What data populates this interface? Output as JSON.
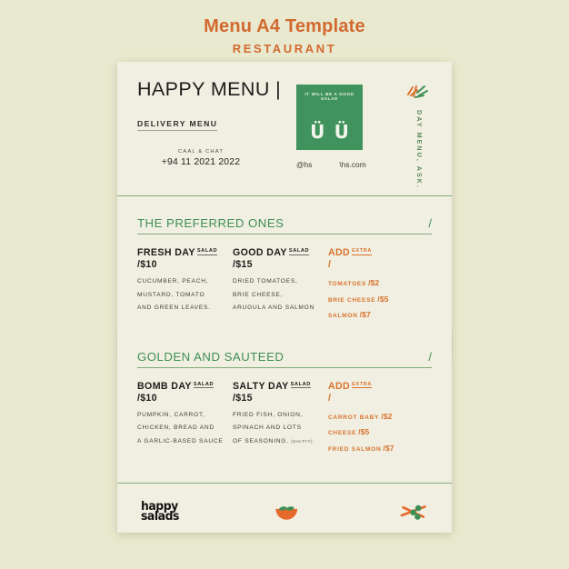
{
  "heading": {
    "title": "Menu A4 Template",
    "subtitle": "RESTAURANT"
  },
  "colors": {
    "page_background": "#e9e9cf",
    "sheet_background": "#f1efe1",
    "accent_orange": "#d2692f",
    "accent_green": "#3e8f56",
    "card_green": "#40935c",
    "circle_green": "#cadfbc",
    "rule_green": "#7fab7e"
  },
  "sheet": {
    "header": {
      "title": "HAPPY MENU  |",
      "subtitle": "DELIVERY MENU",
      "contact_label": "CAAL & CHAT",
      "contact_phone": "+94 11 2021 2022",
      "card": {
        "caption": "IT WILL BE A GOOD SALAD",
        "face_left": "Ü",
        "face_right": "Ü"
      },
      "social": {
        "handle": "@hs",
        "website": "\\hs.com"
      },
      "rail": {
        "vertical_text": "DAY MENU, ASK.",
        "icon": "sprout-icon"
      }
    },
    "sections": [
      {
        "title": "THE PREFERRED ONES",
        "slash": "/",
        "dishes": [
          {
            "name": "FRESH DAY",
            "tag": "SALAD",
            "price": "/$10",
            "lines": [
              "CUCUMBER, PEACH,",
              "MUSTARD, TOMATO",
              "AND GREEN LEAVES."
            ],
            "note": ""
          },
          {
            "name": "GOOD DAY",
            "tag": "SALAD",
            "price": "/$15",
            "lines": [
              "DRIED TOMATOES,",
              "BRIE CHEESE,",
              "ARUGULA AND SALMON"
            ],
            "note": ""
          }
        ],
        "extras": {
          "name": "ADD",
          "tag": "EXTRA",
          "price": "/",
          "items": [
            {
              "label": "TOMATOES",
              "amount": "/$2"
            },
            {
              "label": "BRIE CHEESE",
              "amount": "/$5"
            },
            {
              "label": "SALMON",
              "amount": "/$7"
            }
          ]
        }
      },
      {
        "title": "GOLDEN AND SAUTEED",
        "slash": "/",
        "dishes": [
          {
            "name": "BOMB DAY",
            "tag": "SALAD",
            "price": "/$10",
            "lines": [
              "PUMPKIN, CARROT,",
              "CHICKEN, BREAD AND",
              "A GARLIC-BASED SAUCE"
            ],
            "note": ""
          },
          {
            "name": "SALTY DAY",
            "tag": "SALAD",
            "price": "/$15",
            "lines": [
              "FRIED FISH, ONION,",
              "SPINACH AND LOTS",
              "OF SEASONING."
            ],
            "note": "(SALTYY)"
          }
        ],
        "extras": {
          "name": "ADD",
          "tag": "EXTRA",
          "price": "/",
          "items": [
            {
              "label": "CARROT BABY",
              "amount": "/$2"
            },
            {
              "label": "CHEESE",
              "amount": "/$5"
            },
            {
              "label": "FRIED SALMON",
              "amount": "/$7"
            }
          ]
        }
      }
    ],
    "footer": {
      "logo_line_1": "happy",
      "logo_line_2": "salads",
      "bowl_icon": "salad-bowl-icon",
      "utensils_icon": "crossed-utensils-icon"
    }
  }
}
